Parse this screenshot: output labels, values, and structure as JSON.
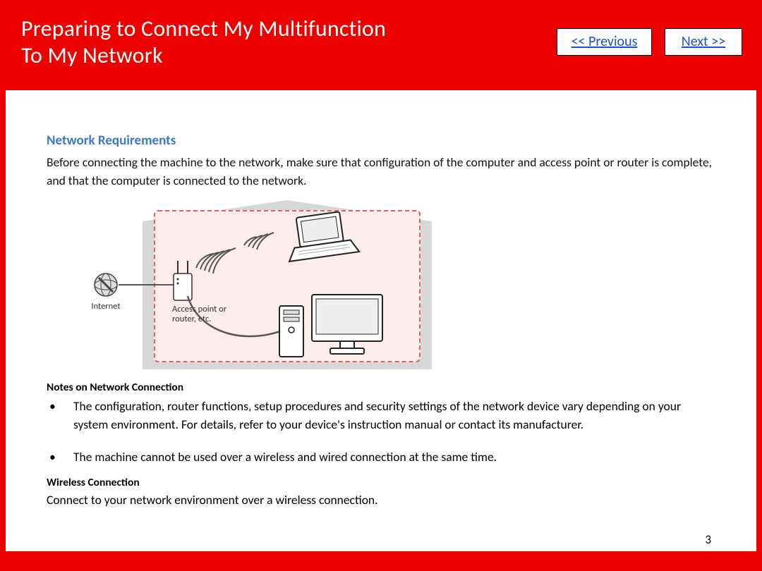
{
  "header": {
    "title_line1": "Preparing to Connect My Multifunction",
    "title_line2": "To My Network",
    "prev_label": "<< Previous",
    "next_label": "Next >>"
  },
  "section": {
    "heading": "Network Requirements",
    "intro": "Before connecting the machine to the network, make sure that configuration of the computer and access point or router is complete, and that the computer is connected to the network."
  },
  "diagram": {
    "internet_label": "Internet",
    "ap_label_line1": "Access point or",
    "ap_label_line2": "router, etc."
  },
  "notes": {
    "heading": "Notes on Network Connection",
    "items": [
      "The configuration, router functions, setup procedures and security settings of the network device vary depending on your system environment. For details, refer to your device's instruction manual or contact its manufacturer.",
      "The machine cannot be used over a wireless and wired connection at the same time."
    ]
  },
  "wireless": {
    "heading": "Wireless Connection",
    "text": "Connect to your network environment over a wireless connection."
  },
  "page_number": "3"
}
